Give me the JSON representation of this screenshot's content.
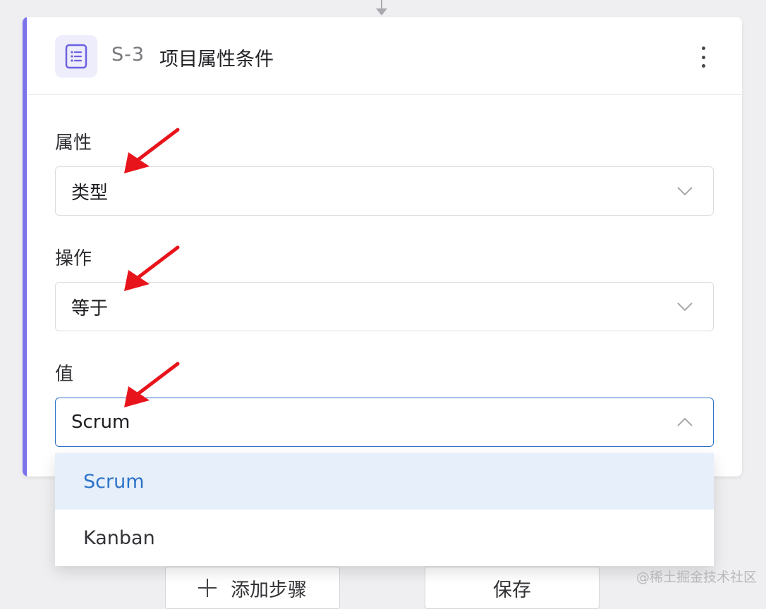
{
  "step": {
    "code": "S-3",
    "title": "项目属性条件",
    "icon": "list-document-icon",
    "accent_color": "#7b73ea"
  },
  "fields": {
    "attribute": {
      "label": "属性",
      "value": "类型"
    },
    "operation": {
      "label": "操作",
      "value": "等于"
    },
    "value": {
      "label": "值",
      "value": "Scrum"
    }
  },
  "dropdown": {
    "options": [
      {
        "label": "Scrum",
        "selected": true
      },
      {
        "label": "Kanban",
        "selected": false
      }
    ],
    "highlight_color": "#e6effa",
    "text_color": "#2e73c8"
  },
  "bottom_bar": {
    "add_step_label": "添加步骤",
    "save_label": "保存"
  },
  "watermark": "@稀土掘金技术社区",
  "annotation_color": "#e8141b"
}
